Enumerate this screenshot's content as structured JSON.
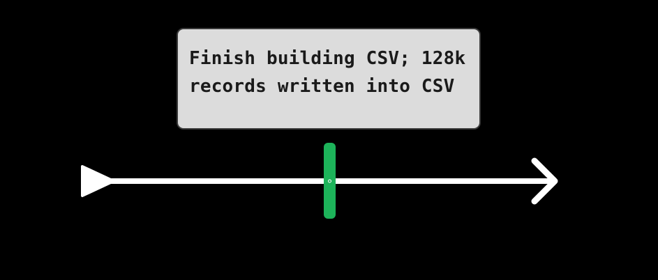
{
  "event_label": "Finish building CSV; 128k records written into CSV",
  "colors": {
    "background": "#000000",
    "axis": "#ffffff",
    "marker": "#1db35a",
    "tooltip_bg": "#dcdcdc",
    "tooltip_border": "#3a3a3a",
    "tooltip_text": "#1a1a1a"
  },
  "icons": {
    "start": "play-triangle-icon",
    "end": "arrow-right-icon"
  }
}
